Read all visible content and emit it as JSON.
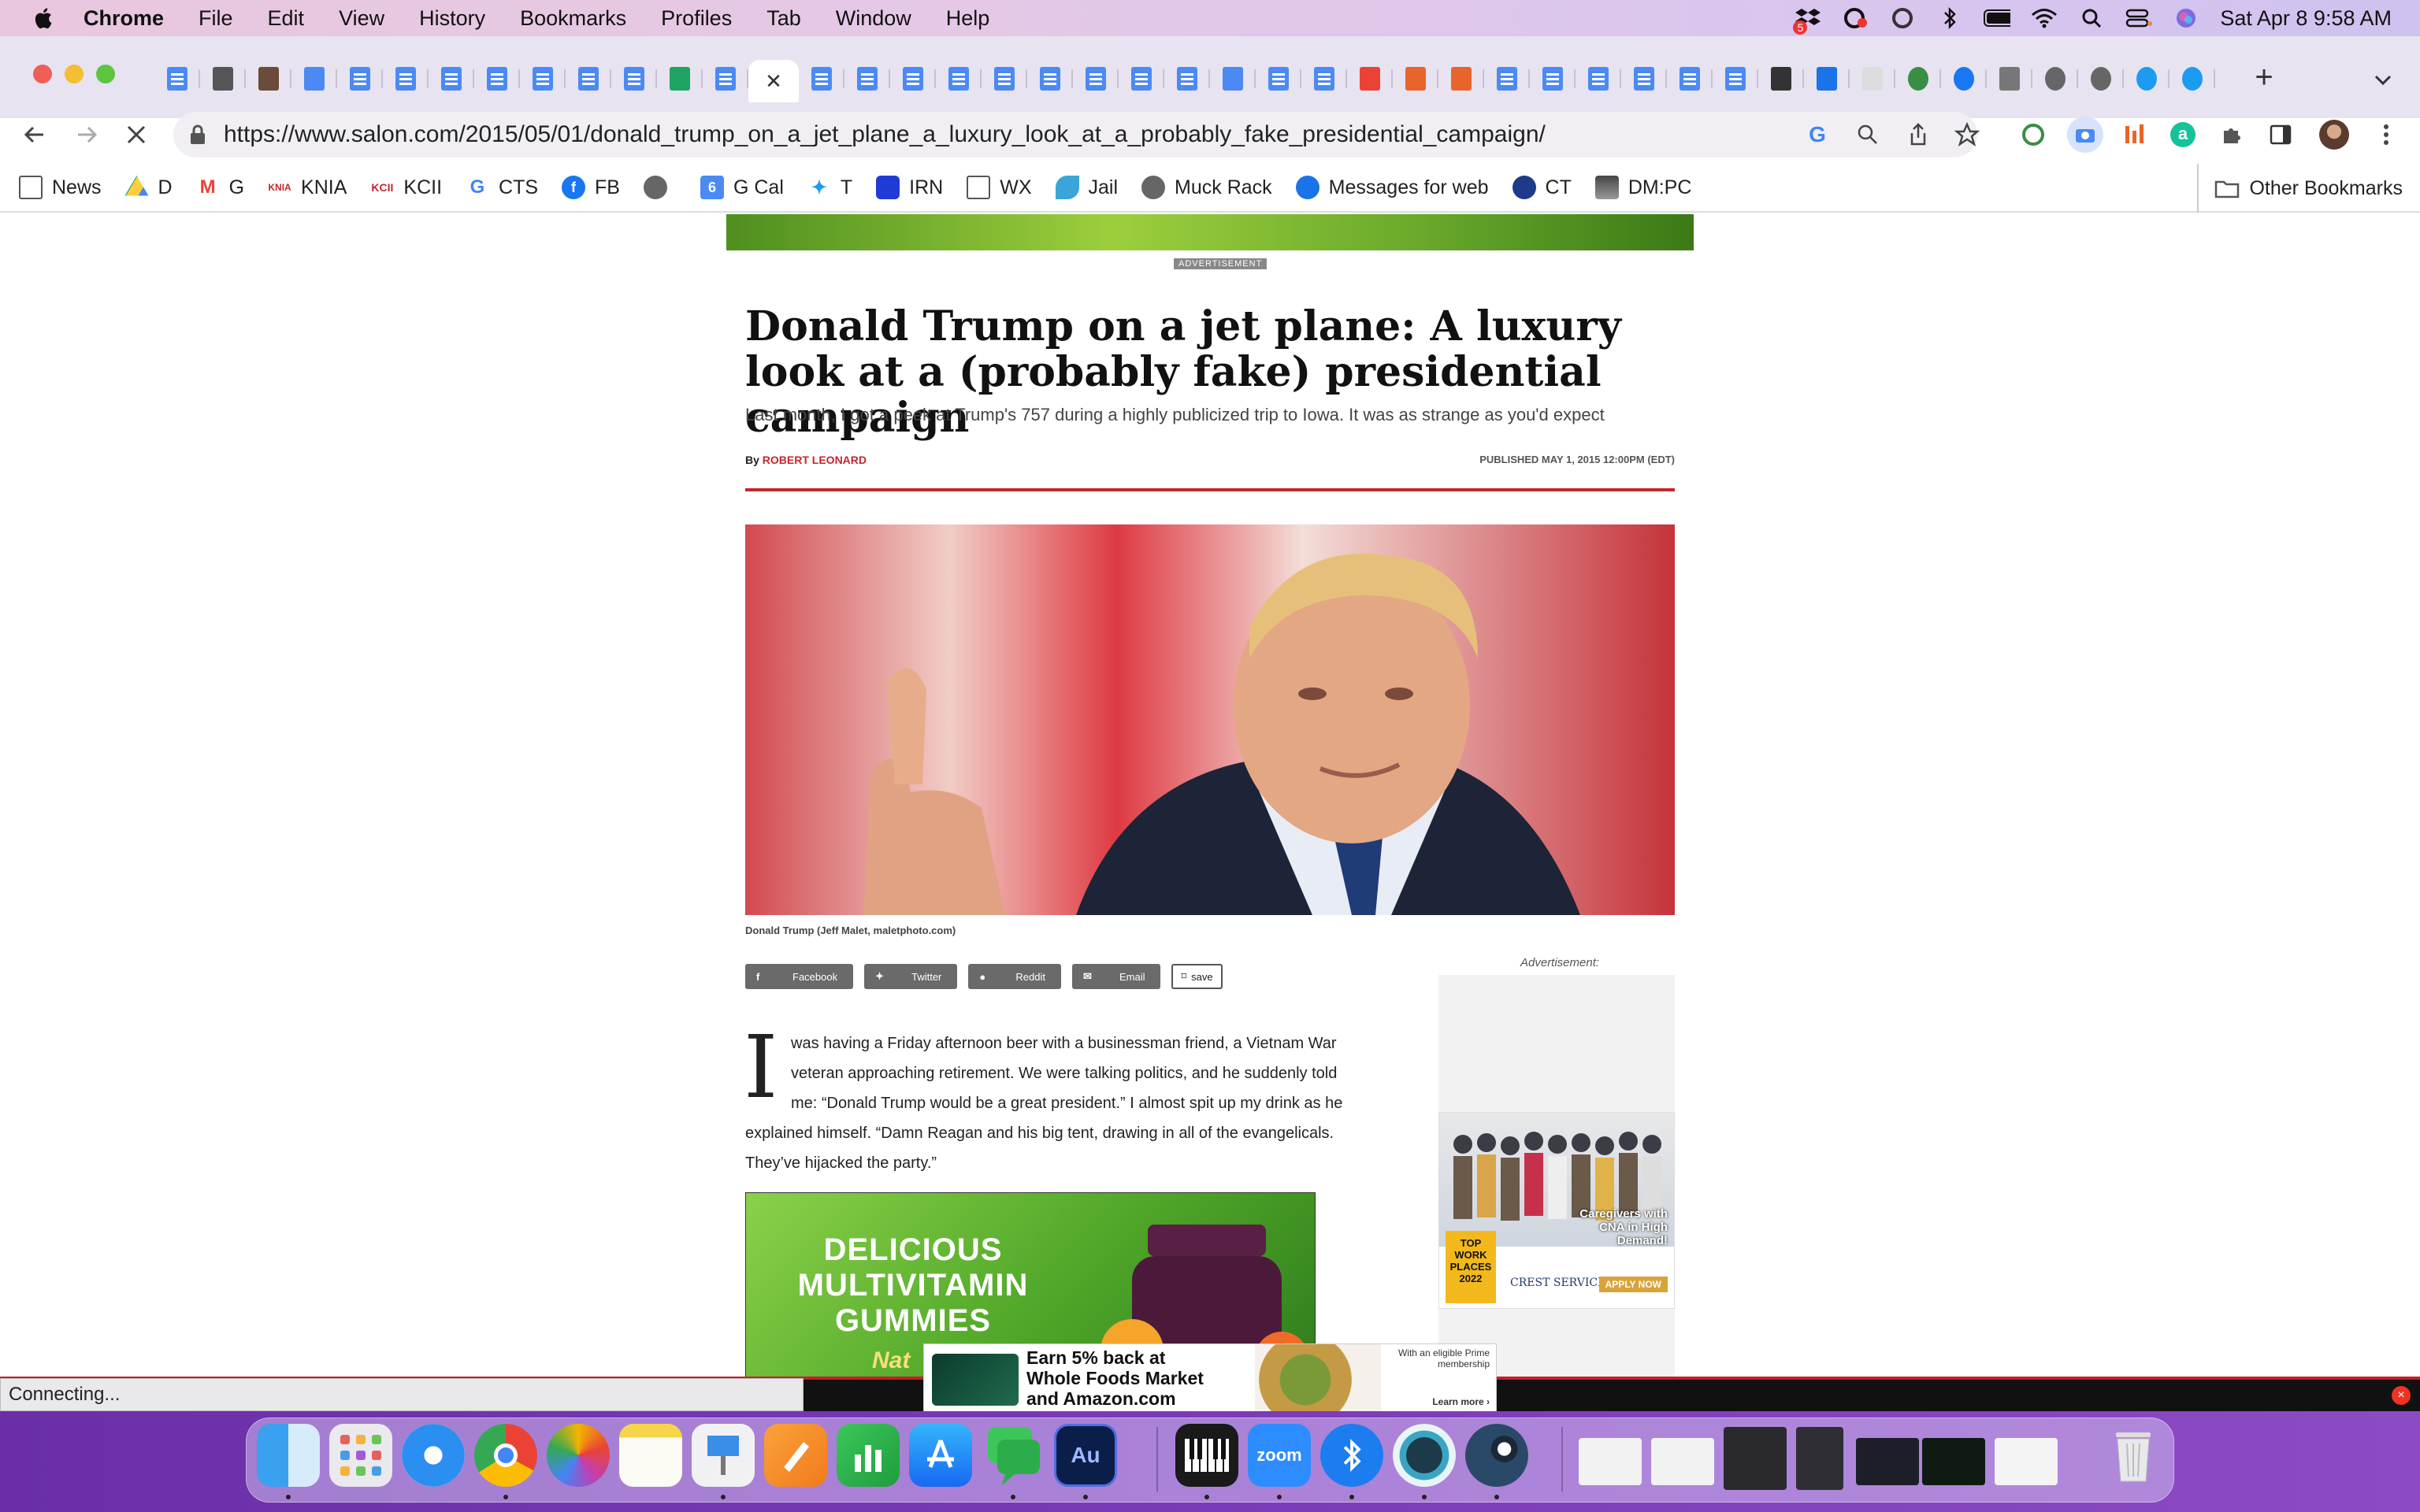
{
  "menubar": {
    "app": "Chrome",
    "items": [
      "File",
      "Edit",
      "View",
      "History",
      "Bookmarks",
      "Profiles",
      "Tab",
      "Window",
      "Help"
    ],
    "clock": "Sat Apr 8  9:58 AM",
    "badge": "5"
  },
  "browser": {
    "url": "https://www.salon.com/2015/05/01/donald_trump_on_a_jet_plane_a_luxury_look_at_a_probably_fake_presidential_campaign/",
    "status": "Connecting...",
    "tab_close_symbol": "✕"
  },
  "bookmarks": [
    {
      "label": "News",
      "icon": "folder-icon"
    },
    {
      "label": "D",
      "icon": "drive-icon"
    },
    {
      "label": "G",
      "icon": "gmail-icon"
    },
    {
      "label": "KNIA",
      "icon": "knia-icon"
    },
    {
      "label": "KCII",
      "icon": "kcii-icon"
    },
    {
      "label": "CTS",
      "icon": "google-icon"
    },
    {
      "label": "FB",
      "icon": "facebook-icon"
    },
    {
      "label": "",
      "icon": "globe-icon"
    },
    {
      "label": "G Cal",
      "icon": "calendar-icon"
    },
    {
      "label": "T",
      "icon": "twitter-icon"
    },
    {
      "label": "IRN",
      "icon": "irn-icon"
    },
    {
      "label": "WX",
      "icon": "folder-icon"
    },
    {
      "label": "Jail",
      "icon": "leaf-icon"
    },
    {
      "label": "Muck Rack",
      "icon": "globe-icon"
    },
    {
      "label": "Messages for web",
      "icon": "messages-icon"
    },
    {
      "label": "CT",
      "icon": "ct-icon"
    },
    {
      "label": "DM:PC",
      "icon": "photo-icon"
    }
  ],
  "other_bookmarks": "Other Bookmarks",
  "tabs_favicons": [
    "doc",
    "pen",
    "library",
    "radio",
    "doc",
    "doc",
    "doc",
    "doc",
    "doc",
    "doc",
    "doc",
    "drive",
    "doc",
    "active",
    "doc",
    "doc",
    "doc",
    "doc",
    "doc",
    "doc",
    "doc",
    "doc",
    "doc",
    "calendar",
    "doc",
    "doc",
    "gmail",
    "bookmark",
    "bookmark",
    "doc",
    "doc",
    "doc",
    "doc",
    "doc",
    "doc",
    "lap",
    "messages",
    "blank",
    "puzzle",
    "facebook",
    "photo",
    "globe",
    "globe",
    "twitter",
    "twitter"
  ],
  "article": {
    "ad_label": "ADVERTISEMENT",
    "headline": "Donald Trump on a jet plane: A luxury look at a (probably fake) presidential campaign",
    "dek": "Last month, I got a peek at Trump's 757 during a highly publicized trip to Iowa. It was as strange as you'd expect",
    "by": "By",
    "author": "ROBERT LEONARD",
    "published": "PUBLISHED MAY 1, 2015 12:00PM (EDT)",
    "caption": "Donald Trump (Jeff Malet, maletphoto.com)",
    "share": {
      "facebook": "Facebook",
      "twitter": "Twitter",
      "reddit": "Reddit",
      "email": "Email",
      "save": "save"
    },
    "dropcap": "I",
    "lines": [
      "was having a Friday afternoon beer with a businessman friend, a Vietnam War",
      "veteran approaching retirement. We were talking politics, and he suddenly told",
      "me: “Donald Trump would be a great president.” I almost spit up my drink as he",
      "explained himself. “Damn Reagan and his big tent, drawing in all of the evangelicals.",
      "They’ve hijacked the party.”"
    ],
    "side_ad_label": "Advertisement:",
    "side_ad": {
      "headline": "Caregivers with CNA in High Demand!",
      "badge": "TOP WORK PLACES 2022",
      "brand": "CREST SERVICES",
      "cta": "APPLY NOW"
    },
    "inline_ad": "DELICIOUS MULTIVITAMIN GUMMIES",
    "inline_ad_fragment": "Nat"
  },
  "bottom_ad": {
    "text": "Earn 5% back at Whole Foods Market and Amazon.com",
    "small": "With an eligible Prime membership",
    "learn": "Learn more ›"
  },
  "dock": [
    "finder",
    "launchpad",
    "safari",
    "chrome",
    "photos",
    "notes",
    "keynote",
    "pages",
    "numbers",
    "app-store",
    "messages",
    "audition",
    "piano",
    "zoom",
    "bluetooth",
    "camo",
    "steam"
  ],
  "dock_labels": {
    "audition": "Au",
    "zoom": "zoom"
  },
  "colors": {
    "salon_red": "#c4262e",
    "tab_bg": "#e8e3f0",
    "doc_blue": "#4c8af3"
  }
}
